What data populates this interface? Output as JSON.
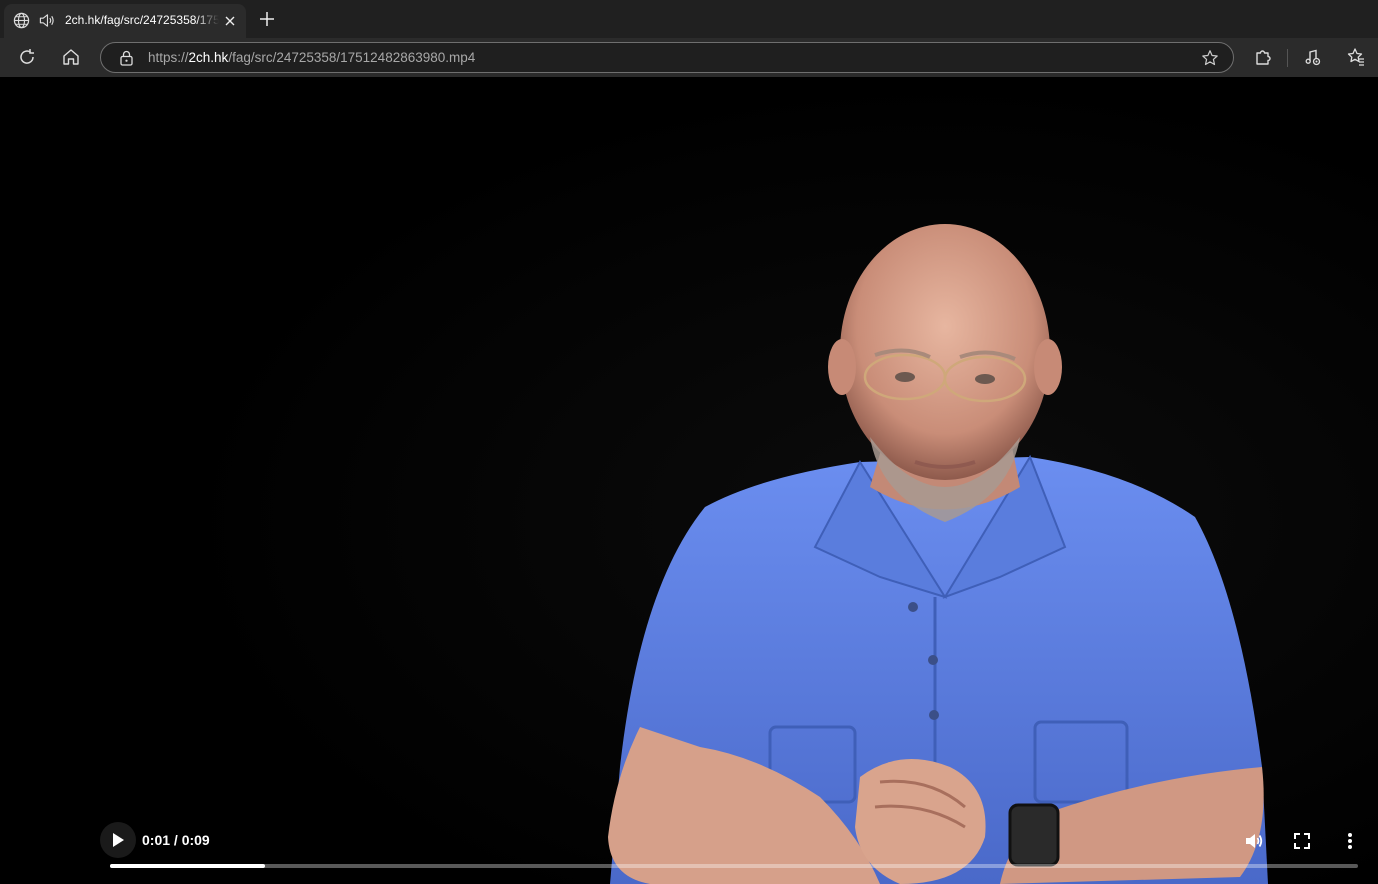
{
  "tab": {
    "title": "2ch.hk/fag/src/24725358/17512482863980.mp4",
    "icons": {
      "favicon": "globe-icon",
      "audio": "speaker-icon",
      "close": "close-icon"
    }
  },
  "toolbar": {
    "url_prefix": "https://",
    "url_host": "2ch.hk",
    "url_path": "/fag/src/24725358/17512482863980.mp4",
    "icons": [
      "reload-icon",
      "home-icon",
      "site-info-icon",
      "favorite-star-icon",
      "extensions-icon",
      "read-aloud-icon",
      "favorites-icon"
    ]
  },
  "video": {
    "time_display": "0:01 / 0:09",
    "progress_fraction": 0.124,
    "controls": [
      "play-icon",
      "volume-icon",
      "fullscreen-icon",
      "more-options-icon"
    ]
  },
  "colors": {
    "tabstrip_bg": "#202020",
    "toolbar_bg": "#2b2b2b",
    "video_bg": "#000000",
    "shirt": "#5c7fe0"
  }
}
